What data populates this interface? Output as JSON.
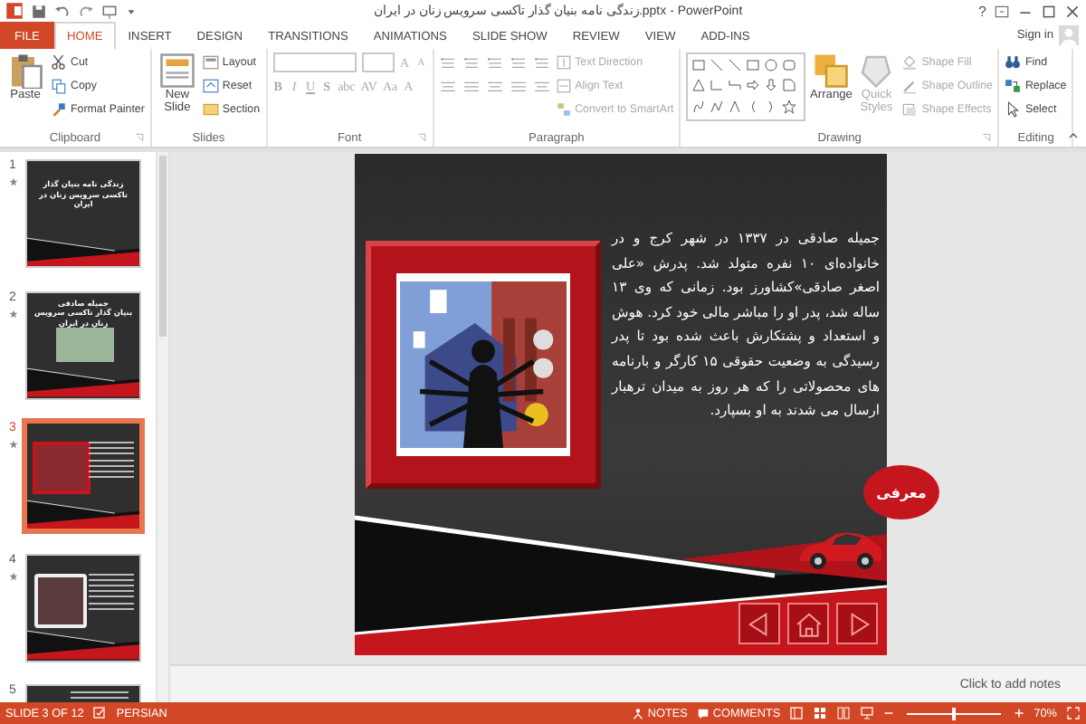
{
  "window": {
    "title": "زندگی نامه بنیان گذار تاکسی سرویس زنان در ایران.pptx - PowerPoint",
    "help": "?",
    "sign_in": "Sign in"
  },
  "tabs": [
    {
      "label": "FILE",
      "kind": "file",
      "selected": false
    },
    {
      "label": "HOME",
      "kind": "tab",
      "selected": true
    },
    {
      "label": "INSERT",
      "kind": "tab",
      "selected": false
    },
    {
      "label": "DESIGN",
      "kind": "tab",
      "selected": false
    },
    {
      "label": "TRANSITIONS",
      "kind": "tab",
      "selected": false
    },
    {
      "label": "ANIMATIONS",
      "kind": "tab",
      "selected": false
    },
    {
      "label": "SLIDE SHOW",
      "kind": "tab",
      "selected": false
    },
    {
      "label": "REVIEW",
      "kind": "tab",
      "selected": false
    },
    {
      "label": "VIEW",
      "kind": "tab",
      "selected": false
    },
    {
      "label": "ADD-INS",
      "kind": "tab",
      "selected": false
    }
  ],
  "ribbon": [
    {
      "label": "Clipboard",
      "kind": "buttons",
      "commands": [
        {
          "kind": "large",
          "label": "Paste",
          "disabled": false
        },
        {
          "kind": "small",
          "label": "Cut",
          "disabled": false
        },
        {
          "kind": "small",
          "label": "Copy",
          "disabled": false
        },
        {
          "kind": "small",
          "label": "Format Painter",
          "disabled": false
        }
      ]
    },
    {
      "label": "Slides",
      "kind": "buttons",
      "commands": [
        {
          "kind": "large",
          "label": "New Slide",
          "disabled": false
        },
        {
          "kind": "small",
          "label": "Layout",
          "disabled": false
        },
        {
          "kind": "small",
          "label": "Reset",
          "disabled": false
        },
        {
          "kind": "small",
          "label": "Section",
          "disabled": false
        }
      ]
    },
    {
      "label": "Font",
      "kind": "grid",
      "rows": [
        [
          {
            "kind": "field"
          },
          {
            "kind": "field"
          },
          {
            "kind": "glyph",
            "label": "A",
            "disabled": true
          },
          {
            "kind": "glyph",
            "label": "A",
            "disabled": true
          }
        ],
        [
          {
            "kind": "glyph",
            "label": "B",
            "disabled": true
          },
          {
            "kind": "glyph",
            "label": "I",
            "disabled": true
          },
          {
            "kind": "glyph",
            "label": "U",
            "disabled": true
          },
          {
            "kind": "glyph",
            "label": "S",
            "disabled": true
          },
          {
            "kind": "glyph",
            "label": "abc",
            "disabled": true
          },
          {
            "kind": "glyph",
            "label": "AV",
            "disabled": true
          },
          {
            "kind": "glyph",
            "label": "Aa",
            "disabled": true
          },
          {
            "kind": "glyph",
            "label": "A",
            "disabled": true
          }
        ]
      ]
    },
    {
      "label": "Paragraph",
      "kind": "buttons",
      "commands": [
        {
          "kind": "icon-grid"
        },
        {
          "kind": "small",
          "label": "Text Direction",
          "disabled": true
        },
        {
          "kind": "small",
          "label": "Align Text",
          "disabled": true
        },
        {
          "kind": "small",
          "label": "Convert to SmartArt",
          "disabled": true
        }
      ]
    },
    {
      "label": "Drawing",
      "kind": "buttons",
      "commands": [
        {
          "kind": "gallery"
        },
        {
          "kind": "large",
          "label": "Arrange",
          "disabled": false
        },
        {
          "kind": "large",
          "label": "Quick Styles",
          "disabled": true
        },
        {
          "kind": "small",
          "label": "Shape Fill",
          "disabled": true
        },
        {
          "kind": "small",
          "label": "Shape Outline",
          "disabled": true
        },
        {
          "kind": "small",
          "label": "Shape Effects",
          "disabled": true
        }
      ]
    },
    {
      "label": "Editing",
      "kind": "buttons",
      "commands": [
        {
          "kind": "small",
          "label": "Find",
          "disabled": false
        },
        {
          "kind": "small",
          "label": "Replace",
          "disabled": false
        },
        {
          "kind": "small",
          "label": "Select",
          "disabled": false
        }
      ]
    }
  ],
  "thumbnails": [
    {
      "number": "1",
      "selected": false,
      "kind": "title",
      "title": "زندگی نامه بنیان گذار تاکسی سرویس زنان در ایران"
    },
    {
      "number": "2",
      "selected": false,
      "kind": "title-picture",
      "title": "جمیله صادقی",
      "subtitle": "بنیان گذار تاکسی سرویس زنان در ایران"
    },
    {
      "number": "3",
      "selected": true,
      "kind": "picture-text"
    },
    {
      "number": "4",
      "selected": false,
      "kind": "picture-text"
    },
    {
      "number": "5",
      "selected": false,
      "kind": "text"
    }
  ],
  "slide": {
    "body": "جمیله صادقی در ۱۳۳۷ در شهر کرج و در خانواده‌ای ۱۰ نفره متولد شد. پدرش «علی اصغر صادقی»کشاورز بود. زمانی که وی ۱۳ ساله شد، پدر او را مباشر مالی خود کرد. هوش و استعداد و پشتکارش باعث شده بود تا پدر رسیدگی به وضعیت حقوقی ۱۵ کارگر و بارنامه های محصولاتی را که هر روز به میدان ترهبار ارسال می شدند به او بسپارد.",
    "callout": "معرفی"
  },
  "notes_prompt": "Click to add notes",
  "status_bar": {
    "slide": "SLIDE 3 OF 12",
    "language": "PERSIAN",
    "notes": "NOTES",
    "comments": "COMMENTS",
    "zoom": {
      "level": 0.5
    },
    "zoom_text": "70%"
  }
}
